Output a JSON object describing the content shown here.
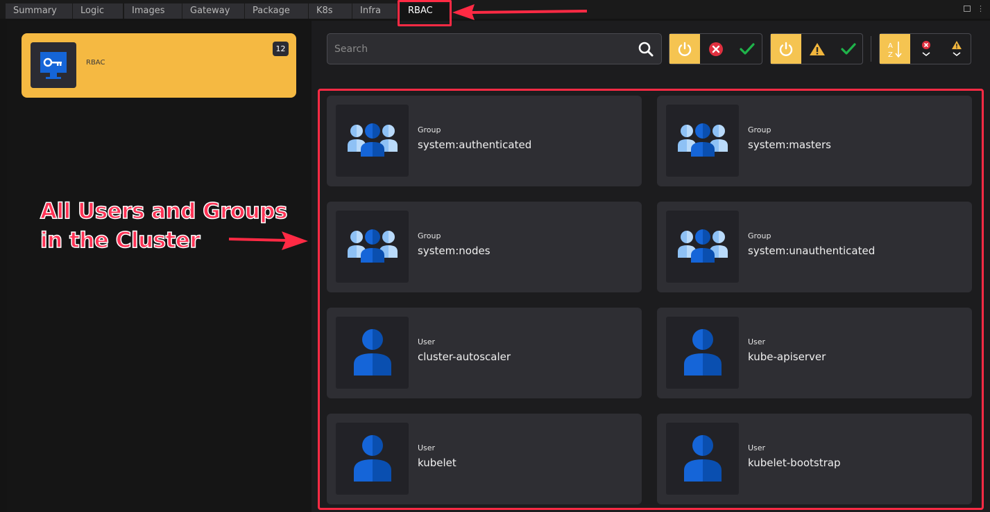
{
  "tabs": [
    {
      "label": "Summary",
      "active": false
    },
    {
      "label": "Logic",
      "active": false
    },
    {
      "label": "Images",
      "active": false
    },
    {
      "label": "Gateway",
      "active": false
    },
    {
      "label": "Package",
      "active": false
    },
    {
      "label": "K8s",
      "active": false
    },
    {
      "label": "Infra",
      "active": false
    },
    {
      "label": "RBAC",
      "active": true
    }
  ],
  "sidebar": {
    "card": {
      "label": "RBAC",
      "count": "12",
      "icon": "monitor-key-icon"
    }
  },
  "toolbar": {
    "search_placeholder": "Search",
    "filter_group_1": [
      "power-icon",
      "error-icon",
      "check-icon"
    ],
    "filter_group_2": [
      "power-icon",
      "warning-icon",
      "check-icon"
    ],
    "sort_group": [
      "sort-az-icon",
      "sort-error-icon",
      "sort-warning-icon"
    ]
  },
  "subjects": [
    {
      "type": "Group",
      "name": "system:authenticated",
      "icon": "group-icon"
    },
    {
      "type": "Group",
      "name": "system:masters",
      "icon": "group-icon"
    },
    {
      "type": "Group",
      "name": "system:nodes",
      "icon": "group-icon"
    },
    {
      "type": "Group",
      "name": "system:unauthenticated",
      "icon": "group-icon"
    },
    {
      "type": "User",
      "name": "cluster-autoscaler",
      "icon": "user-icon"
    },
    {
      "type": "User",
      "name": "kube-apiserver",
      "icon": "user-icon"
    },
    {
      "type": "User",
      "name": "kubelet",
      "icon": "user-icon"
    },
    {
      "type": "User",
      "name": "kubelet-bootstrap",
      "icon": "user-icon"
    }
  ],
  "annotation": {
    "line1": "All Users and Groups",
    "line2": "in the Cluster"
  },
  "colors": {
    "accent": "#f5b942",
    "annotation_red": "#ff2a44",
    "icon_blue_dark": "#0a4fb0",
    "icon_blue_light": "#8ec1f5"
  }
}
